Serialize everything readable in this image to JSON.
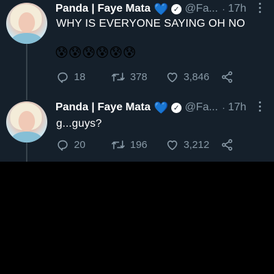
{
  "colors": {
    "background": "#15202b",
    "text_primary": "#ffffff",
    "text_secondary": "#8899a6",
    "badge_heart": "#4a97e8"
  },
  "tweets": [
    {
      "display_name": "Panda | Faye Mata",
      "badge_emoji": "💙",
      "handle": "@Fa...",
      "dot": "·",
      "time": "17h",
      "text": "WHY IS EVERYONE SAYING OH NO",
      "emojis": "😰😰😰😰😰😰",
      "replies": "18",
      "retweets": "378",
      "likes": "3,846"
    },
    {
      "display_name": "Panda | Faye Mata",
      "badge_emoji": "💙",
      "handle": "@Fa...",
      "dot": "·",
      "time": "17h",
      "text": "g...guys?",
      "replies": "20",
      "retweets": "196",
      "likes": "3,212"
    }
  ],
  "icons": {
    "reply": "reply-icon",
    "retweet": "retweet-icon",
    "like": "like-icon",
    "share": "share-icon",
    "more": "more-icon",
    "verified": "verified-icon"
  }
}
